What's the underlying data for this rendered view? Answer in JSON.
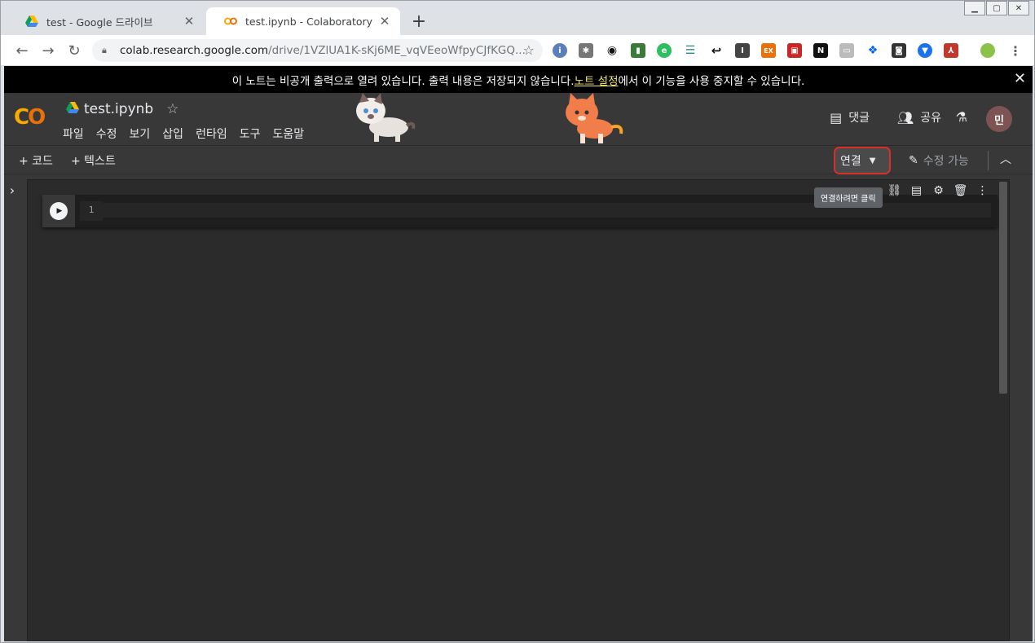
{
  "browser": {
    "tabs": [
      {
        "title": "test - Google 드라이브",
        "icon": "google-drive-icon",
        "active": false
      },
      {
        "title": "test.ipynb - Colaboratory",
        "icon": "colab-icon",
        "active": true
      }
    ],
    "url_domain": "colab.research.google.com",
    "url_path": "/drive/1VZlUA1K-sKj6ME_vqVEeoWfpyCJfKGQ..."
  },
  "banner": {
    "text_before": "이 노트는 비공개 출력으로 열려 있습니다. 출력 내용은 저장되지 않습니다. ",
    "link": "노트 설정",
    "text_after": "에서 이 기능을 사용 중지할 수 있습니다."
  },
  "header": {
    "logo": "CO",
    "notebook_title": "test.ipynb",
    "menus": [
      "파일",
      "수정",
      "보기",
      "삽입",
      "런타임",
      "도구",
      "도움말"
    ],
    "comment_label": "댓글",
    "share_label": "공유",
    "avatar_letter": "민"
  },
  "actionbar": {
    "add_code": "+ 코드",
    "add_text": "+ 텍스트",
    "connect_label": "연결",
    "edit_label": "수정 가능"
  },
  "cell": {
    "line_number": "1",
    "tooltip": "연결하려면 클릭"
  },
  "colors": {
    "page_bg": "#383838",
    "banner_bg": "#000000",
    "link_yellow": "#f5e56b",
    "highlight_red": "#d93025",
    "colab_orange": "#f9ab00"
  }
}
